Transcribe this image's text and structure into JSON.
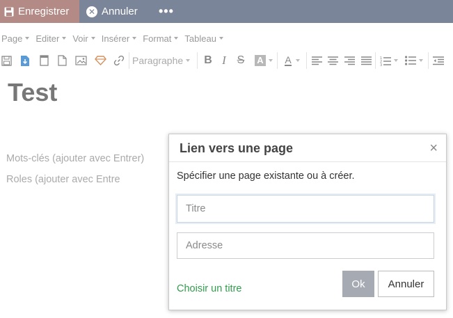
{
  "topbar": {
    "save_label": "Enregistrer",
    "cancel_label": "Annuler",
    "more_label": "•••",
    "background": "#7b8599",
    "save_background": "#b38a85"
  },
  "menubar": {
    "items": [
      {
        "label": "Page"
      },
      {
        "label": "Editer"
      },
      {
        "label": "Voir"
      },
      {
        "label": "Insérer"
      },
      {
        "label": "Format"
      },
      {
        "label": "Tableau"
      }
    ]
  },
  "toolbar": {
    "block_format": "Paragraphe",
    "bold": "B",
    "italic": "I",
    "strikethrough": "S",
    "highlight": "A",
    "text_color": "A"
  },
  "editor": {
    "title": "Test",
    "keywords_placeholder": "Mots-clés (ajouter avec Entrer)",
    "roles_placeholder": "Roles (ajouter avec Entre"
  },
  "dialog": {
    "title": "Lien vers une page",
    "close_label": "×",
    "description": "Spécifier une page existante ou à créer.",
    "title_placeholder": "Titre",
    "address_placeholder": "Adresse",
    "choose_title_link": "Choisir un titre",
    "ok_label": "Ok",
    "cancel_label": "Annuler",
    "link_color": "#2f9e4a"
  }
}
